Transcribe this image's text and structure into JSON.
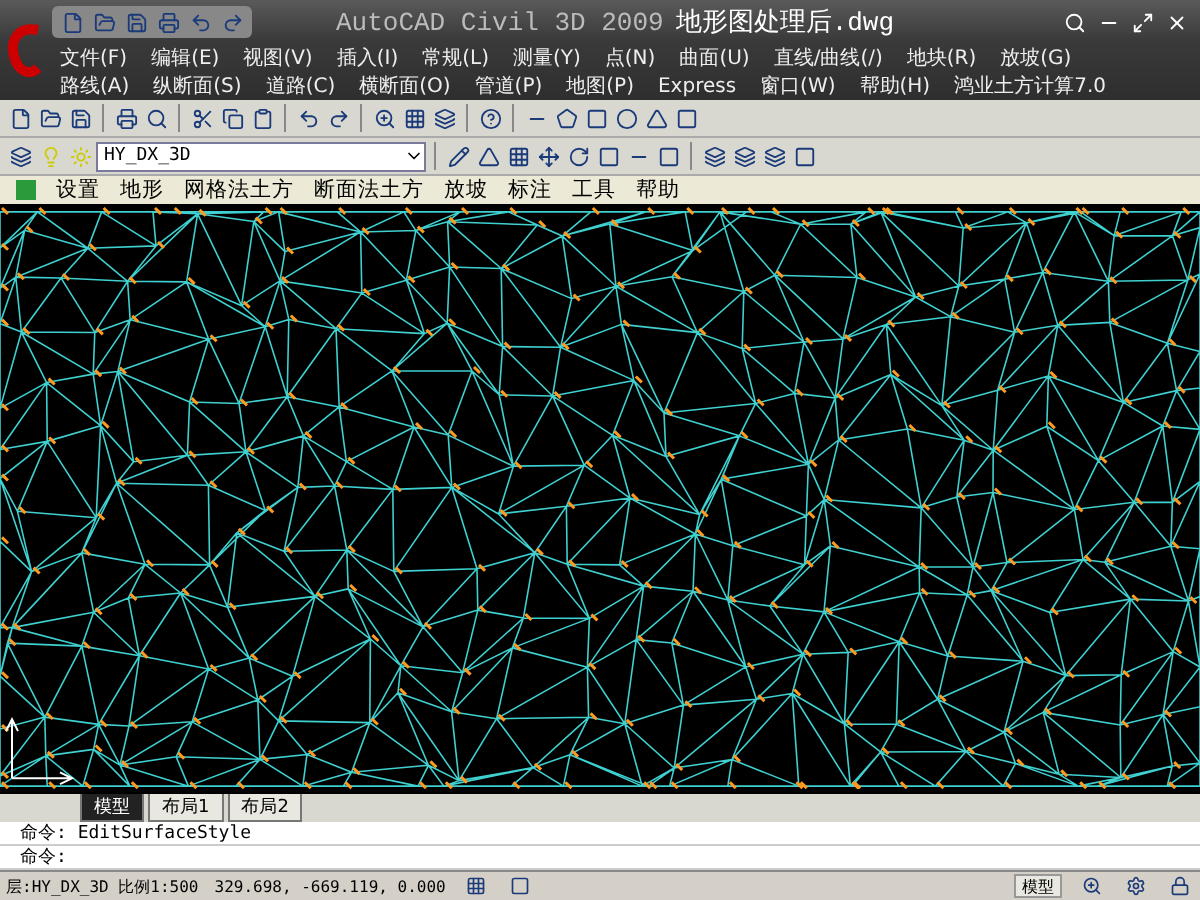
{
  "window": {
    "title": "AutoCAD Civil 3D 2009",
    "file": "地形图处理后.dwg"
  },
  "menu_rows": [
    [
      "文件(F)",
      "编辑(E)",
      "视图(V)",
      "插入(I)",
      "常规(L)",
      "测量(Y)",
      "点(N)",
      "曲面(U)",
      "直线/曲线(/)",
      "地块(R)",
      "放坡(G)"
    ],
    [
      "路线(A)",
      "纵断面(S)",
      "道路(C)",
      "横断面(O)",
      "管道(P)",
      "地图(P)",
      "Express",
      "窗口(W)",
      "帮助(H)",
      "鸿业土方计算7.0"
    ]
  ],
  "layer": {
    "value": "HY_DX_3D"
  },
  "custom_menu": [
    "设置",
    "地形",
    "网格法土方",
    "断面法土方",
    "放坡",
    "标注",
    "工具",
    "帮助"
  ],
  "layout_tabs": [
    {
      "label": "模型",
      "selected": true
    },
    {
      "label": "布局1",
      "selected": false
    },
    {
      "label": "布局2",
      "selected": false
    }
  ],
  "command_lines": [
    "命令: EditSurfaceStyle",
    "命令:"
  ],
  "status_bar": {
    "layer": "层:HY_DX_3D 比例1:500",
    "coordinates": "329.698,  -669.119, 0.000",
    "model_button": "模型"
  }
}
